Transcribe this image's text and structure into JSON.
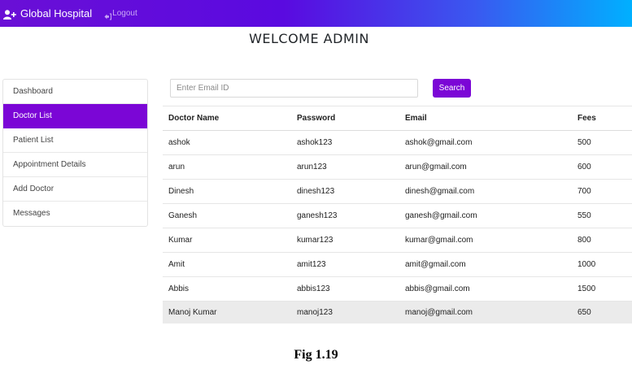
{
  "navbar": {
    "brand": "Global Hospital",
    "brand_icon": "user-plus-icon",
    "logout_label": "Logout",
    "logout_icon": "sign-out-icon",
    "gradient_colors": [
      "#6a0fd6",
      "#5a0ae0",
      "#00b0ff"
    ]
  },
  "page": {
    "title": "WELCOME ADMIN"
  },
  "sidebar": {
    "items": [
      {
        "label": "Dashboard",
        "active": false
      },
      {
        "label": "Doctor List",
        "active": true
      },
      {
        "label": "Patient List",
        "active": false
      },
      {
        "label": "Appointment Details",
        "active": false
      },
      {
        "label": "Add Doctor",
        "active": false
      },
      {
        "label": "Messages",
        "active": false
      }
    ],
    "active_color": "#7b06d6"
  },
  "search": {
    "placeholder": "Enter Email ID",
    "value": "",
    "button_label": "Search",
    "button_color": "#7b06d6"
  },
  "table": {
    "headers": [
      "Doctor Name",
      "Password",
      "Email",
      "Fees"
    ],
    "rows": [
      [
        "ashok",
        "ashok123",
        "ashok@gmail.com",
        "500"
      ],
      [
        "arun",
        "arun123",
        "arun@gmail.com",
        "600"
      ],
      [
        "Dinesh",
        "dinesh123",
        "dinesh@gmail.com",
        "700"
      ],
      [
        "Ganesh",
        "ganesh123",
        "ganesh@gmail.com",
        "550"
      ],
      [
        "Kumar",
        "kumar123",
        "kumar@gmail.com",
        "800"
      ],
      [
        "Amit",
        "amit123",
        "amit@gmail.com",
        "1000"
      ],
      [
        "Abbis",
        "abbis123",
        "abbis@gmail.com",
        "1500"
      ],
      [
        "Manoj Kumar",
        "manoj123",
        "manoj@gmail.com",
        "650"
      ]
    ],
    "highlighted_row": 7
  },
  "caption": "Fig 1.19"
}
